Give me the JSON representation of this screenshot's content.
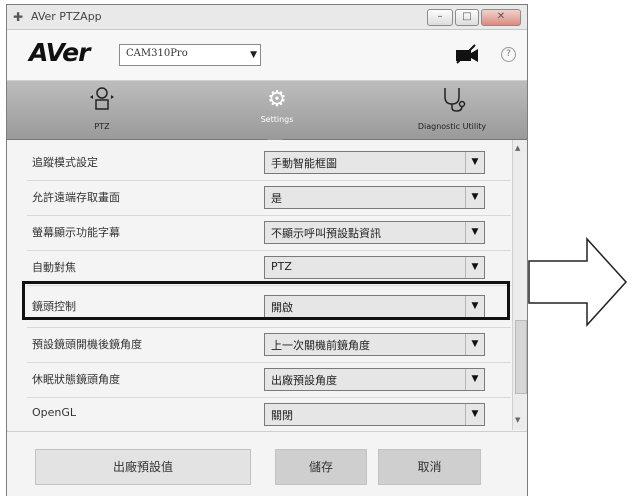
{
  "window": {
    "title": "AVer PTZApp",
    "title_icon": "wifi-icon"
  },
  "header": {
    "logo": "AVer",
    "camera_select": {
      "value": "CAM310Pro"
    },
    "icons": [
      "camera-off-icon",
      "help-icon"
    ]
  },
  "tabs": [
    {
      "label": "PTZ",
      "icon": "ptz-camera-icon",
      "active": false
    },
    {
      "label": "Settings",
      "icon": "gear-icon",
      "active": true
    },
    {
      "label": "Diagnostic Utility",
      "icon": "stethoscope-icon",
      "active": false
    }
  ],
  "settings": [
    {
      "label": "追蹤模式設定",
      "value": "手動智能框圖"
    },
    {
      "label": "允許遠端存取畫面",
      "value": "是"
    },
    {
      "label": "螢幕顯示功能字幕",
      "value": "不顯示呼叫預設點資訊"
    },
    {
      "label": "自動對焦",
      "value": "PTZ"
    },
    {
      "label": "鏡頭控制",
      "value": "開啟"
    },
    {
      "label": "預設鏡頭開機後鏡角度",
      "value": "上一次關機前鏡角度"
    },
    {
      "label": "休眠狀態鏡頭角度",
      "value": "出廠預設角度"
    },
    {
      "label": "OpenGL",
      "value": "關閉"
    }
  ],
  "footer": {
    "factory_default": "出廠預設值",
    "save": "儲存",
    "cancel": "取消"
  },
  "colors": {
    "tabbar": "#a8a8a8",
    "highlight_border": "#111111"
  }
}
